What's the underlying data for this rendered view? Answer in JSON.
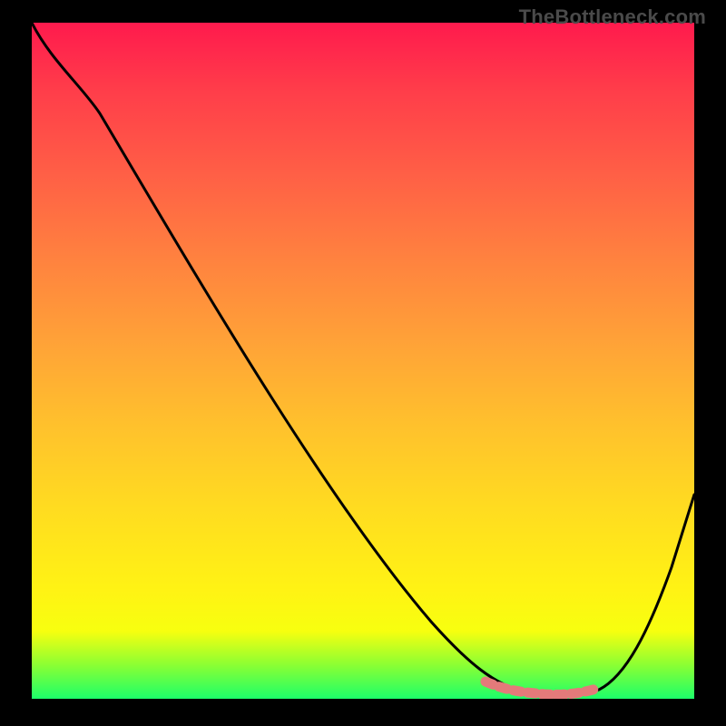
{
  "watermark": "TheBottleneck.com",
  "chart_data": {
    "type": "line",
    "title": "",
    "xlabel": "",
    "ylabel": "",
    "xlim": [
      0,
      1
    ],
    "ylim": [
      0,
      1
    ],
    "series": [
      {
        "name": "curve",
        "x": [
          0.0,
          0.05,
          0.1,
          0.15,
          0.2,
          0.25,
          0.3,
          0.35,
          0.4,
          0.45,
          0.5,
          0.55,
          0.6,
          0.65,
          0.7,
          0.75,
          0.8,
          0.83,
          0.86,
          0.9,
          0.95,
          1.0
        ],
        "y": [
          1.0,
          0.96,
          0.9,
          0.83,
          0.75,
          0.67,
          0.59,
          0.51,
          0.43,
          0.35,
          0.27,
          0.2,
          0.13,
          0.07,
          0.03,
          0.01,
          0.0,
          0.0,
          0.01,
          0.06,
          0.16,
          0.3
        ]
      },
      {
        "name": "highlight",
        "x": [
          0.7,
          0.72,
          0.74,
          0.76,
          0.78,
          0.8,
          0.82,
          0.84,
          0.86
        ],
        "y": [
          0.025,
          0.018,
          0.012,
          0.008,
          0.005,
          0.004,
          0.005,
          0.009,
          0.016
        ]
      }
    ],
    "colors": {
      "gradient_top": "#ff1a4d",
      "gradient_mid": "#ffdc20",
      "gradient_bottom": "#1cff6a",
      "curve": "#000000",
      "highlight": "#e47a7a",
      "frame": "#000000"
    }
  }
}
